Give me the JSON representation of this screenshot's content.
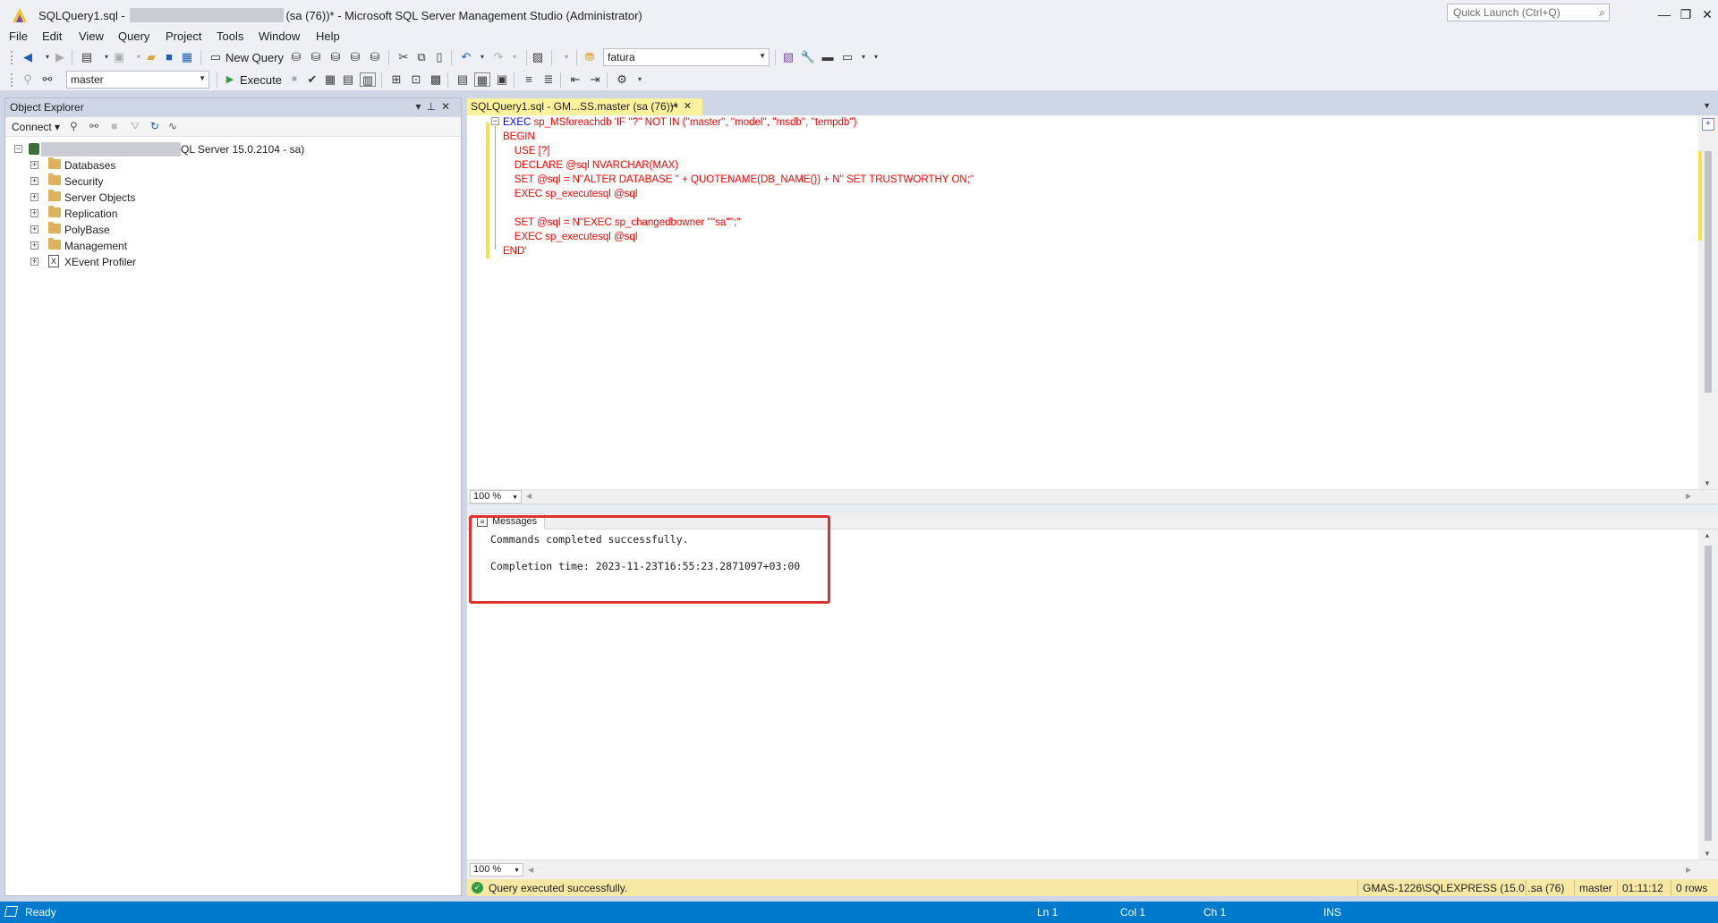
{
  "window": {
    "title_prefix": "SQLQuery1.sql - ",
    "title_suffix": "(sa (76))* - Microsoft SQL Server Management Studio (Administrator)",
    "quick_launch_placeholder": "Quick Launch (Ctrl+Q)",
    "minimize": "—",
    "restore": "❐",
    "close": "✕"
  },
  "menu": [
    "File",
    "Edit",
    "View",
    "Query",
    "Project",
    "Tools",
    "Window",
    "Help"
  ],
  "toolbar1": {
    "new_query_label": "New Query",
    "database_combo_value": "fatura"
  },
  "toolbar2": {
    "db_combo_value": "master",
    "execute_label": "Execute"
  },
  "object_explorer": {
    "header": "Object Explorer",
    "connect_label": "Connect",
    "server_node": "QL Server 15.0.2104 - sa)",
    "nodes": [
      "Databases",
      "Security",
      "Server Objects",
      "Replication",
      "PolyBase",
      "Management",
      "XEvent Profiler"
    ]
  },
  "document": {
    "tab_title": "SQLQuery1.sql - GM...SS.master (sa (76))*",
    "code": {
      "l1_kw": "EXEC",
      "l1_rest": " sp_MSforeachdb 'IF ''?'' NOT IN (''master'', ''model'', ''msdb'', ''tempdb'')",
      "l2": "BEGIN",
      "l3": "    USE [?]",
      "l4": "    DECLARE @sql NVARCHAR(MAX)",
      "l5": "    SET @sql = N''ALTER DATABASE '' + QUOTENAME(DB_NAME()) + N'' SET TRUSTWORTHY ON;''",
      "l6": "    EXEC sp_executesql @sql",
      "l7": "    SET @sql = N''EXEC sp_changedbowner ''''sa'''';''",
      "l8": "    EXEC sp_executesql @sql",
      "l9": "END'"
    },
    "zoom": "100 %"
  },
  "results": {
    "tab_label": "Messages",
    "line1": "Commands completed successfully.",
    "line2": "Completion time: 2023-11-23T16:55:23.2871097+03:00",
    "zoom": "100 %"
  },
  "query_status": {
    "message": "Query executed successfully.",
    "server": "GMAS-1226\\SQLEXPRESS (15.0 ...",
    "user": "sa (76)",
    "database": "master",
    "elapsed": "01:11:12",
    "rows": "0 rows"
  },
  "statusbar": {
    "ready": "Ready",
    "ln": "Ln 1",
    "col": "Col 1",
    "ch": "Ch 1",
    "mode": "INS"
  },
  "colors": {
    "accent": "#007acc",
    "highlight_box": "#e0302d",
    "tab_active": "#fff29d",
    "string_red": "#ff0000",
    "keyword_blue": "#0000ff"
  }
}
